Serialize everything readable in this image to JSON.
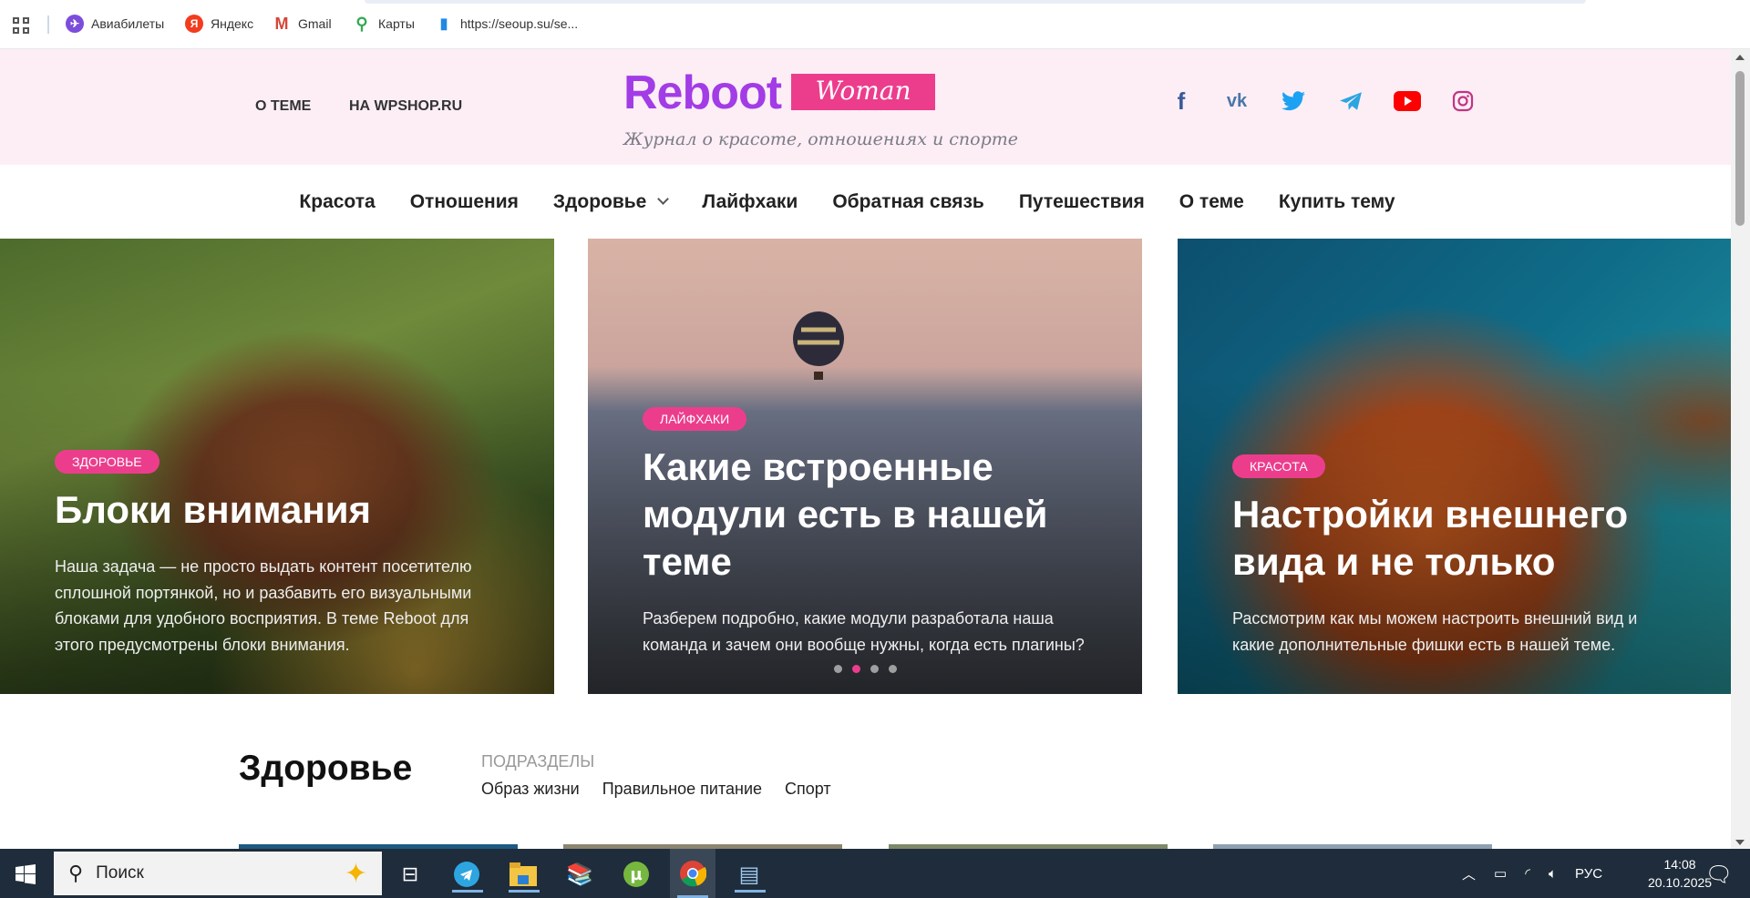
{
  "bookmarks": [
    {
      "label": "Авиабилеты",
      "icon": "globe-plane-icon",
      "color": "#7c4ddb"
    },
    {
      "label": "Яндекс",
      "icon": "yandex-icon",
      "color": "#f33b1d"
    },
    {
      "label": "Gmail",
      "icon": "gmail-icon",
      "color": "#d44638"
    },
    {
      "label": "Карты",
      "icon": "maps-pin-icon",
      "color": "#34a853"
    },
    {
      "label": "https://seoup.su/se...",
      "icon": "bar-chart-icon",
      "color": "#1e88e5"
    }
  ],
  "header": {
    "links": [
      "О ТЕМЕ",
      "НА WPSHOP.RU"
    ],
    "logo": {
      "main": "Reboot",
      "badge": "Woman",
      "tagline": "Журнал о красоте, отношениях и спорте"
    },
    "social": [
      {
        "name": "facebook",
        "glyph": "f",
        "color": "#3b5998"
      },
      {
        "name": "vk",
        "glyph": "vk",
        "color": "#4a76a8"
      },
      {
        "name": "twitter",
        "glyph": "🐦",
        "color": "#1da1f2"
      },
      {
        "name": "telegram",
        "glyph": "➤",
        "color": "#2ca5e0"
      },
      {
        "name": "youtube",
        "glyph": "▶",
        "color": "#ff0000"
      },
      {
        "name": "instagram",
        "glyph": "◎",
        "color": "#c13584"
      }
    ]
  },
  "nav": [
    "Красота",
    "Отношения",
    "Здоровье",
    "Лайфхаки",
    "Обратная связь",
    "Путешествия",
    "О теме",
    "Купить тему"
  ],
  "slider": {
    "cards": [
      {
        "badge": "Здоровье",
        "title": "Блоки внимания",
        "text": "Наша задача — не просто выдать контент посетителю сплошной портянкой, но и разбавить его визуальными блоками для удобного восприятия. В теме Reboot для этого предусмотрены блоки внимания."
      },
      {
        "badge": "Лайфхаки",
        "title": "Какие встроенные модули есть в нашей теме",
        "text": "Разберем подробно, какие модули разработала наша команда и зачем они вообще нужны, когда есть плагины?"
      },
      {
        "badge": "Красота",
        "title": "Настройки внешнего вида и не только",
        "text": "Рассмотрим как мы можем настроить внешний вид и какие дополнительные фишки есть в нашей теме."
      }
    ],
    "active_dot": 2,
    "dot_count": 4
  },
  "section": {
    "title": "Здоровье",
    "sub_label": "ПОДРАЗДЕЛЫ",
    "links": [
      "Образ жизни",
      "Правильное питание",
      "Спорт"
    ]
  },
  "taskbar": {
    "search_placeholder": "Поиск",
    "lang": "РУС",
    "time": "14:08",
    "date": "20.10.2025"
  },
  "colors": {
    "accent": "#ec3d8d",
    "logo": "#a23ce6",
    "header_bg": "#fdeef6"
  }
}
